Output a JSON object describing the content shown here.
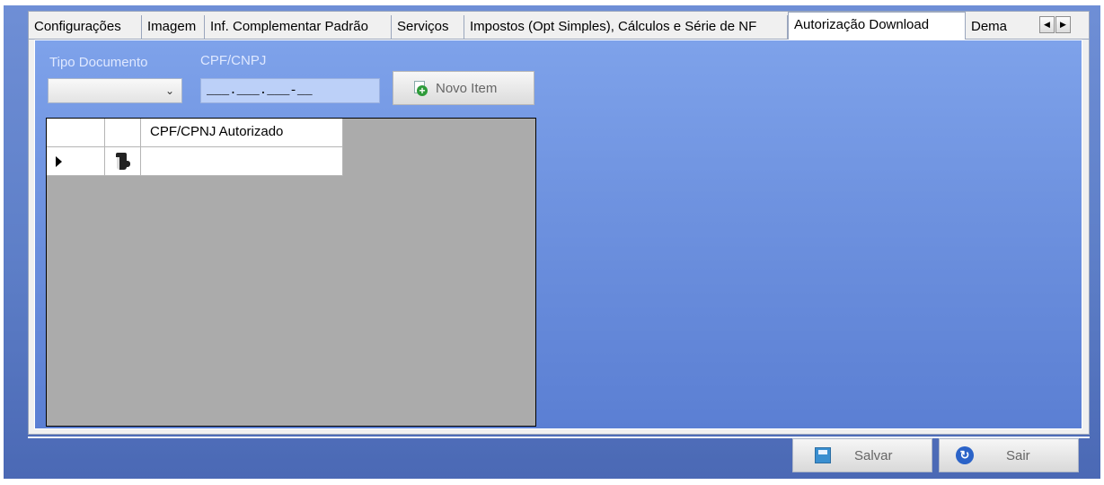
{
  "tabs": [
    {
      "label": "Configurações"
    },
    {
      "label": "Imagem"
    },
    {
      "label": "Inf. Complementar Padrão"
    },
    {
      "label": "Serviços"
    },
    {
      "label": "Impostos (Opt Simples), Cálculos e Série de NF"
    },
    {
      "label": "Autorização Download"
    },
    {
      "label": "Dema"
    }
  ],
  "tab_scroll": {
    "left_icon": "arrow-left-icon",
    "right_icon": "arrow-right-icon"
  },
  "form": {
    "tipo_label": "Tipo Documento",
    "tipo_value": "",
    "cpf_label": "CPF/CNPJ",
    "cpf_mask": "___.___.___-__",
    "novo_item_label": "Novo Item"
  },
  "grid": {
    "columns": [
      "",
      "",
      "CPF/CPNJ Autorizado"
    ],
    "rows": [
      {
        "value": ""
      }
    ]
  },
  "footer": {
    "save_label": "Salvar",
    "exit_label": "Sair"
  }
}
